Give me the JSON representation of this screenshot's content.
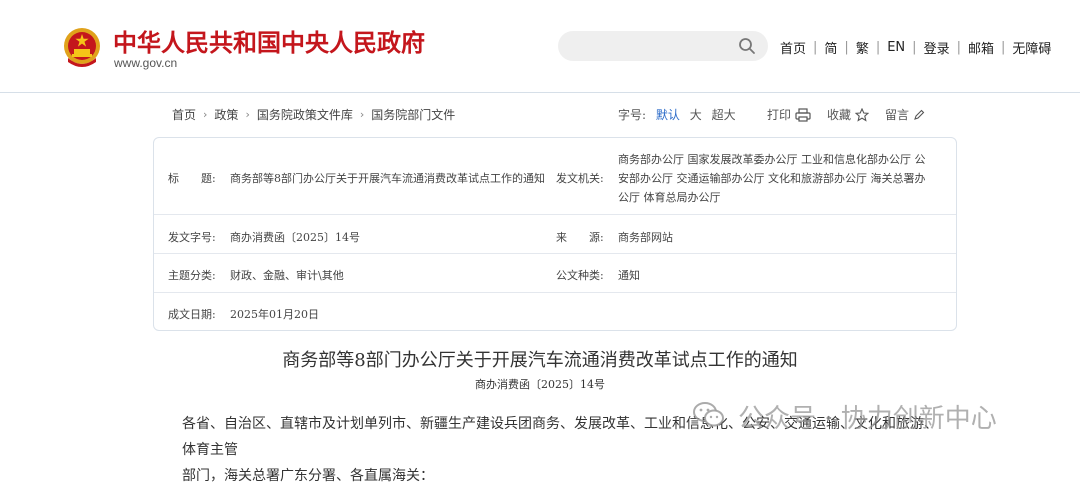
{
  "header": {
    "site_title": "中华人民共和国中央人民政府",
    "site_url": "www.gov.cn",
    "nav": [
      "首页",
      "简",
      "繁",
      "EN",
      "登录",
      "邮箱",
      "无障碍"
    ]
  },
  "breadcrumb": [
    "首页",
    "政策",
    "国务院政策文件库",
    "国务院部门文件"
  ],
  "font_size": {
    "label": "字号:",
    "options": [
      "默认",
      "大",
      "超大"
    ],
    "active": "默认"
  },
  "tools": {
    "print": "打印",
    "favorite": "收藏",
    "comment": "留言"
  },
  "info": {
    "title_label": "标　　题:",
    "title_value": "商务部等8部门办公厅关于开展汽车流通消费改革试点工作的通知",
    "issuer_label": "发文机关:",
    "issuer_lines": [
      "商务部办公厅  国家发展改革委办公厅  工业和信息化部办公厅  公",
      "安部办公厅  交通运输部办公厅  文化和旅游部办公厅  海关总署办",
      "公厅  体育总局办公厅"
    ],
    "doc_no_label": "发文字号:",
    "doc_no_value": "商办消费函〔2025〕14号",
    "source_label": "来　　源:",
    "source_value": "商务部网站",
    "topic_label": "主题分类:",
    "topic_value": "财政、金融、审计\\其他",
    "type_label": "公文种类:",
    "type_value": "通知",
    "date_label": "成文日期:",
    "date_value": "2025年01月20日"
  },
  "document": {
    "title": "商务部等8部门办公厅关于开展汽车流通消费改革试点工作的通知",
    "doc_no": "商办消费函〔2025〕14号",
    "body_lines": [
      "各省、自治区、直辖市及计划单列市、新疆生产建设兵团商务、发展改革、工业和信息化、公安、交通运输、文化和旅游、体育主管",
      "部门，海关总署广东分署、各直属海关："
    ]
  },
  "watermark": {
    "text": "公众号 · 协力创新中心"
  },
  "colors": {
    "brand_red": "#c4161c",
    "link_blue": "#2a6ac8",
    "border": "#dbe2ea"
  }
}
